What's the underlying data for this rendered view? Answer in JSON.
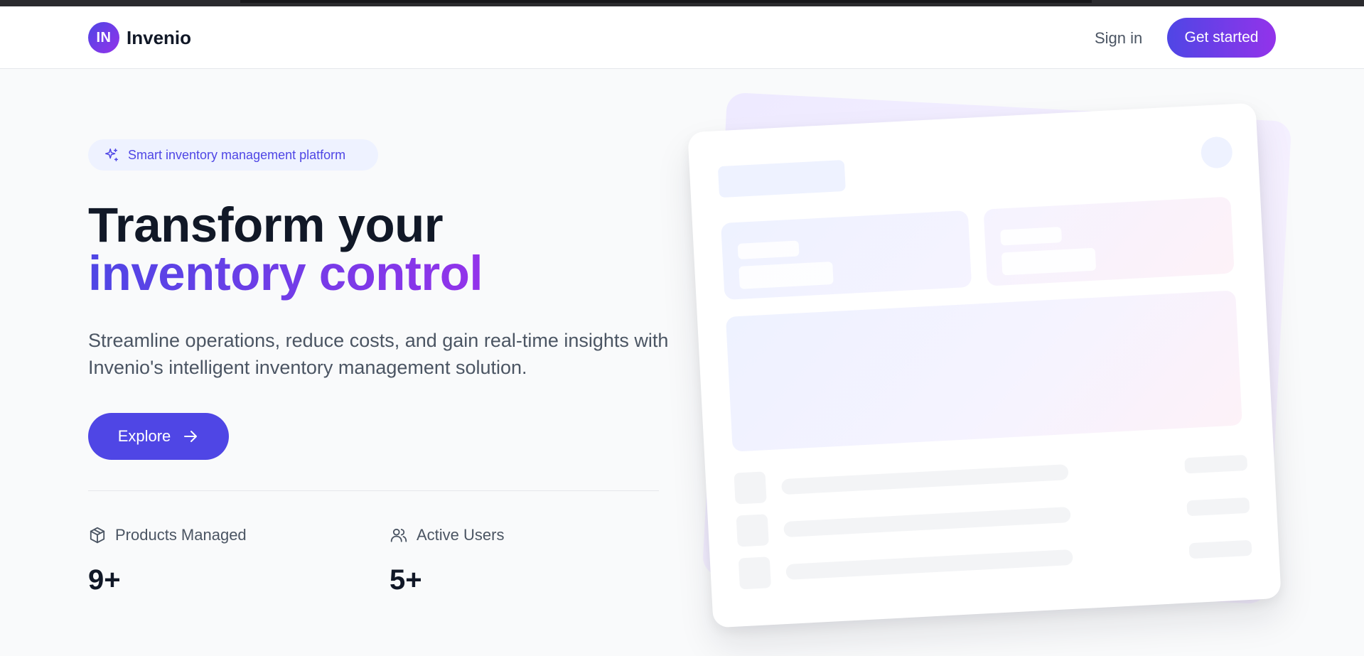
{
  "nav": {
    "logo_text": "IN",
    "brand": "Invenio",
    "signin_label": "Sign in",
    "cta_label": "Get started"
  },
  "hero": {
    "badge": "Smart inventory management platform",
    "badge_icon": "sparkles-icon",
    "title_plain": "Transform your ",
    "title_highlight": "inventory control",
    "subtitle": "Streamline operations, reduce costs, and gain real-time insights with Invenio's intelligent inventory management solution.",
    "explore_label": "Explore",
    "explore_icon": "arrow-right-icon"
  },
  "stats": [
    {
      "label": "Products Managed",
      "value": "9+",
      "icon": "package-icon"
    },
    {
      "label": "Active Users",
      "value": "5+",
      "icon": "users-icon"
    }
  ],
  "colors": {
    "accent": "#4f46e5",
    "accent_end": "#9333ea",
    "text": "#111827",
    "muted": "#4b5563"
  }
}
